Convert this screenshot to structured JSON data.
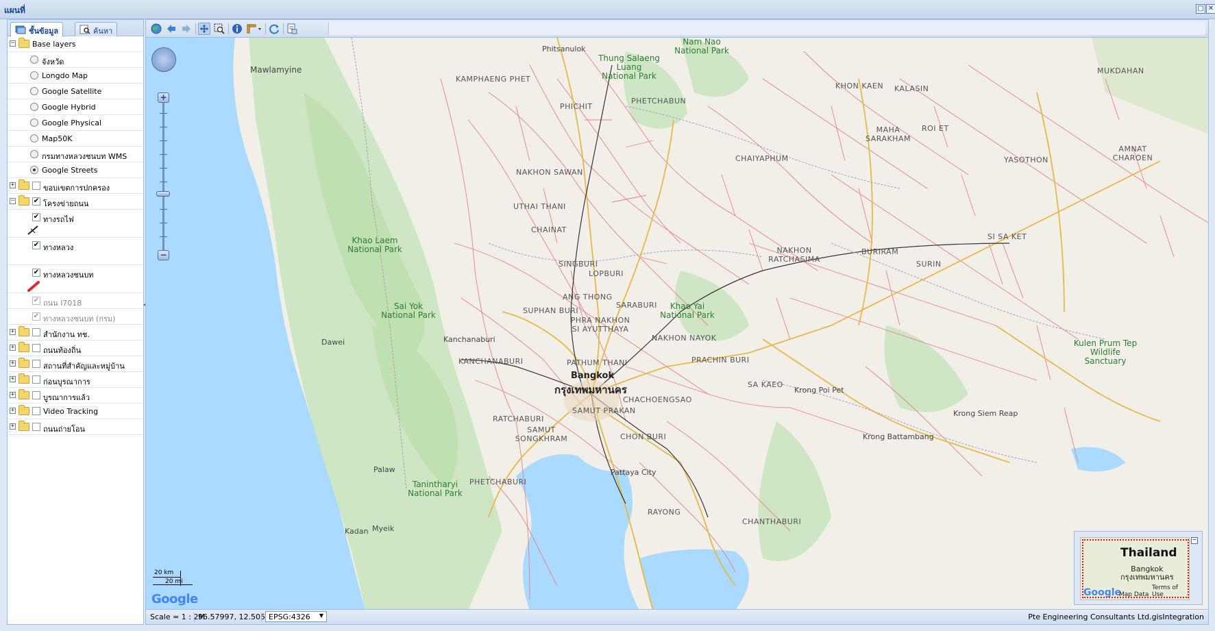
{
  "window": {
    "title": "แผนที่",
    "maximize_label": "□",
    "close_label": "✕"
  },
  "tabs": [
    {
      "label": "ชั้นข้อมูล",
      "active": true
    },
    {
      "label": "ค้นหา",
      "active": false
    }
  ],
  "tree": {
    "base_layers": {
      "label": "Base layers",
      "expander": "−"
    },
    "base_items": [
      {
        "label": "จังหวัด",
        "selected": false
      },
      {
        "label": "Longdo Map",
        "selected": false
      },
      {
        "label": "Google Satellite",
        "selected": false
      },
      {
        "label": "Google Hybrid",
        "selected": false
      },
      {
        "label": "Google Physical",
        "selected": false
      },
      {
        "label": "Map50K",
        "selected": false
      },
      {
        "label": "กรมทางหลวงชนบท WMS",
        "selected": false
      },
      {
        "label": "Google Streets",
        "selected": true
      }
    ],
    "admin_boundary": {
      "label": "ขอบเขตการปกครอง",
      "expander": "+"
    },
    "road_network": {
      "label": "โครงข่ายถนน",
      "expander": "−",
      "children": [
        {
          "label": "ทางรถไฟ",
          "checked": true,
          "dim": false
        },
        {
          "label": "ทางหลวง",
          "checked": true,
          "dim": false
        },
        {
          "label": "ทางหลวงชนบท",
          "checked": true,
          "dim": false
        },
        {
          "label": "ถนน l7018",
          "checked": true,
          "dim": true
        },
        {
          "label": "ทางหลวงชนบท (กรม)",
          "checked": true,
          "dim": true
        }
      ]
    },
    "groups": [
      {
        "label": "สำนักงาน ทช.",
        "expander": "+"
      },
      {
        "label": "ถนนท้องถิ่น",
        "expander": "+"
      },
      {
        "label": "สถานที่สำคัญและหมู่บ้าน",
        "expander": "+"
      },
      {
        "label": "ก่อนบูรณาการ",
        "expander": "+"
      },
      {
        "label": "บูรณาการแล้ว",
        "expander": "+"
      },
      {
        "label": "Video Tracking",
        "expander": "+"
      },
      {
        "label": "ถนนถ่ายโอน",
        "expander": "+"
      }
    ],
    "check_mark": "✔"
  },
  "toolbar": {
    "icons": [
      "globe-icon",
      "back-arrow-icon",
      "forward-arrow-icon",
      "pan-icon",
      "zoom-box-icon",
      "info-icon",
      "measure-icon",
      "refresh-icon",
      "print-icon"
    ]
  },
  "map": {
    "zoom_in": "+",
    "zoom_out": "−",
    "scale_km": "20 km",
    "scale_mi": "20 mi",
    "google": "Google",
    "cities": [
      {
        "name": "Bangkok",
        "big": true
      },
      {
        "name": "กรุงเทพมหานคร",
        "big": true
      },
      {
        "name": "Mawlamyine"
      },
      {
        "name": "Phitsanulok"
      },
      {
        "name": "Kanchanaburi"
      },
      {
        "name": "Pattaya City"
      },
      {
        "name": "Dawei"
      },
      {
        "name": "Krong Poi Pet"
      },
      {
        "name": "Krong Battambang"
      },
      {
        "name": "Krong Siem Reap"
      },
      {
        "name": "Palaw"
      },
      {
        "name": "Myeik"
      },
      {
        "name": "Kadan"
      }
    ],
    "provinces": [
      {
        "name": "KAMPHAENG PHET"
      },
      {
        "name": "PHICHIT"
      },
      {
        "name": "PHETCHABUN"
      },
      {
        "name": "NAKHON SAWAN"
      },
      {
        "name": "UTHAI THANI"
      },
      {
        "name": "CHAINAT"
      },
      {
        "name": "SINGBURI"
      },
      {
        "name": "LOPBURI"
      },
      {
        "name": "ANG THONG"
      },
      {
        "name": "SARABURI"
      },
      {
        "name": "SUPHAN BURI"
      },
      {
        "name": "PHRA NAKHON SI AYUTTHAYA"
      },
      {
        "name": "NAKHON NAYOK"
      },
      {
        "name": "PRACHIN BURI"
      },
      {
        "name": "KANCHANABURI"
      },
      {
        "name": "PATHUM THANI"
      },
      {
        "name": "CHACHOENGSAO"
      },
      {
        "name": "SAMUT PRAKAN"
      },
      {
        "name": "RATCHABURI"
      },
      {
        "name": "SAMUT SONGKHRAM"
      },
      {
        "name": "CHON BURI"
      },
      {
        "name": "PHETCHABURI"
      },
      {
        "name": "RAYONG"
      },
      {
        "name": "CHANTHABURI"
      },
      {
        "name": "SA KAEO"
      },
      {
        "name": "CHAIYAPHUM"
      },
      {
        "name": "KHON KAEN"
      },
      {
        "name": "KALASIN"
      },
      {
        "name": "MAHA SARAKHAM"
      },
      {
        "name": "ROI ET"
      },
      {
        "name": "YASOTHON"
      },
      {
        "name": "NAKHON RATCHASIMA"
      },
      {
        "name": "BURIRAM"
      },
      {
        "name": "SURIN"
      },
      {
        "name": "SI SA KET"
      },
      {
        "name": "MUKDAHAN"
      },
      {
        "name": "AMNAT CHAROEN"
      }
    ],
    "parks": [
      {
        "name": "Khao Laem National Park"
      },
      {
        "name": "Sai Yok National Park"
      },
      {
        "name": "Khao Yai National Park"
      },
      {
        "name": "Thung Salaeng Luang National Park"
      },
      {
        "name": "Nam Nao National Park"
      },
      {
        "name": "Tanintharyi National Park"
      },
      {
        "name": "Kulen Prum Tep Wildlife Sanctuary"
      }
    ],
    "overview": {
      "country": "Thailand",
      "city": "Bangkok",
      "city_th": "กรุงเทพมหานคร",
      "google": "Google",
      "map_data": "Map Data",
      "terms": "Terms of Use",
      "minimize": "−"
    }
  },
  "status": {
    "scale": "Scale = 1 : 2M",
    "coords": "96.57997, 12.50510",
    "projection": "EPSG:4326",
    "projection_arrow": "▼",
    "credit": "Pte Engineering Consultants Ltd.gisIntegration"
  },
  "colors": {
    "sea": "#aadaff",
    "land": "#f2efe9",
    "forest": "#c8e6c0",
    "road_red": "#e8747c",
    "road_yellow": "#f4d06f",
    "accent": "#15428b"
  }
}
